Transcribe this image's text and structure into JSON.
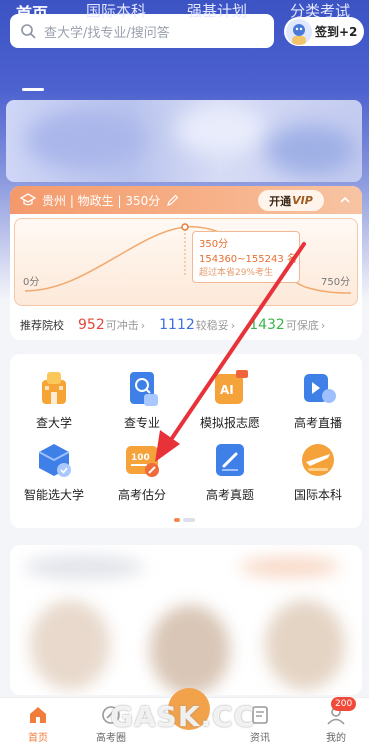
{
  "search": {
    "placeholder": "查大学/找专业/搜问答"
  },
  "signin": {
    "label": "签到+2"
  },
  "tabs": [
    {
      "label": "首页"
    },
    {
      "label": "国际本科"
    },
    {
      "label": "强基计划"
    },
    {
      "label": "分类考试"
    }
  ],
  "score_card": {
    "info": "贵州 | 物政生 | 350分",
    "vip_prefix": "开通",
    "vip_label": "VIP",
    "tip_score": "350分",
    "tip_rank": "154360~155243 名",
    "tip_beat": "超过本省29%考生",
    "axis_min": "0分",
    "axis_max": "750分",
    "rec_label": "推荐院校",
    "rec_items": [
      {
        "num": "952",
        "label": "可冲击",
        "color": "#e4473b"
      },
      {
        "num": "1112",
        "label": "较稳妥",
        "color": "#3d6fe0"
      },
      {
        "num": "1432",
        "label": "可保底",
        "color": "#3bb54a"
      }
    ]
  },
  "grid": [
    {
      "label": "查大学",
      "icon": "university-icon"
    },
    {
      "label": "查专业",
      "icon": "major-search-icon"
    },
    {
      "label": "模拟报志愿",
      "icon": "ai-application-icon"
    },
    {
      "label": "高考直播",
      "icon": "live-icon"
    },
    {
      "label": "智能选大学",
      "icon": "smart-select-icon"
    },
    {
      "label": "高考估分",
      "icon": "score-estimate-icon"
    },
    {
      "label": "高考真题",
      "icon": "exam-papers-icon"
    },
    {
      "label": "国际本科",
      "icon": "international-icon"
    }
  ],
  "nav": [
    {
      "label": "首页",
      "icon": "home-icon"
    },
    {
      "label": "高考圈",
      "icon": "circle-icon"
    },
    {
      "label": "资讯",
      "icon": "news-icon"
    },
    {
      "label": "我的",
      "icon": "profile-icon"
    }
  ],
  "nav_badge": "200",
  "watermark": "GASK.CC",
  "colors": {
    "accent": "#f07d3c",
    "header_blue": "#3c53c4",
    "arrow_red": "#e8323a"
  }
}
